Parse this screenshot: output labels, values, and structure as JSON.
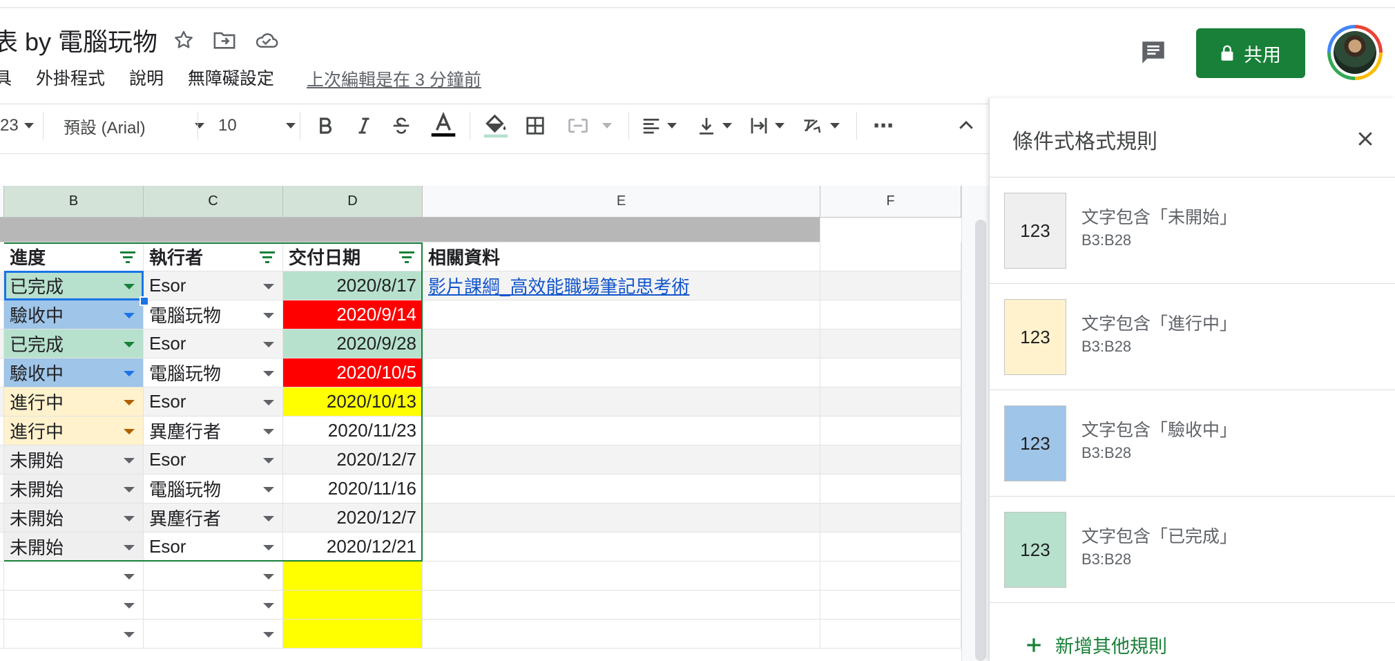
{
  "header": {
    "title": "表 by 電腦玩物",
    "menu": [
      "具",
      "外掛程式",
      "說明",
      "無障礙設定"
    ],
    "last_edit": "上次編輯是在 3 分鐘前",
    "share_label": "共用"
  },
  "toolbar": {
    "num_format": "23",
    "font": "預設 (Arial)",
    "font_size": "10",
    "more": "⋯"
  },
  "sheet": {
    "columns": [
      "B",
      "C",
      "D",
      "E",
      "F"
    ],
    "headers": [
      "進度",
      "執行者",
      "交付日期",
      "相關資料"
    ],
    "rows": [
      {
        "status": "已完成",
        "owner": "Esor",
        "date": "2020/8/17",
        "link": "影片課綱_高效能職場筆記思考術"
      },
      {
        "status": "驗收中",
        "owner": "電腦玩物",
        "date": "2020/9/14",
        "link": ""
      },
      {
        "status": "已完成",
        "owner": "Esor",
        "date": "2020/9/28",
        "link": ""
      },
      {
        "status": "驗收中",
        "owner": "電腦玩物",
        "date": "2020/10/5",
        "link": ""
      },
      {
        "status": "進行中",
        "owner": "Esor",
        "date": "2020/10/13",
        "link": ""
      },
      {
        "status": "進行中",
        "owner": "異塵行者",
        "date": "2020/11/23",
        "link": ""
      },
      {
        "status": "未開始",
        "owner": "Esor",
        "date": "2020/12/7",
        "link": ""
      },
      {
        "status": "未開始",
        "owner": "電腦玩物",
        "date": "2020/11/16",
        "link": ""
      },
      {
        "status": "未開始",
        "owner": "異塵行者",
        "date": "2020/12/7",
        "link": ""
      },
      {
        "status": "未開始",
        "owner": "Esor",
        "date": "2020/12/21",
        "link": ""
      }
    ],
    "status_colors": {
      "已完成": "#b7e1cd",
      "驗收中": "#9fc5e8",
      "進行中": "#fff2cc",
      "未開始": "#efefef"
    },
    "date_colors": [
      "#b7e1cd",
      "#ff0000",
      "#b7e1cd",
      "#ff0000",
      "#ffff00",
      "",
      "",
      "",
      "",
      ""
    ]
  },
  "panel": {
    "title": "條件式格式規則",
    "rules": [
      {
        "preview": "123",
        "text": "文字包含「未開始」",
        "range": "B3:B28",
        "color": "#efefef"
      },
      {
        "preview": "123",
        "text": "文字包含「進行中」",
        "range": "B3:B28",
        "color": "#fff2cc"
      },
      {
        "preview": "123",
        "text": "文字包含「驗收中」",
        "range": "B3:B28",
        "color": "#9fc5e8"
      },
      {
        "preview": "123",
        "text": "文字包含「已完成」",
        "range": "B3:B28",
        "color": "#b7e1cd"
      }
    ],
    "add_rule": "新增其他規則"
  }
}
